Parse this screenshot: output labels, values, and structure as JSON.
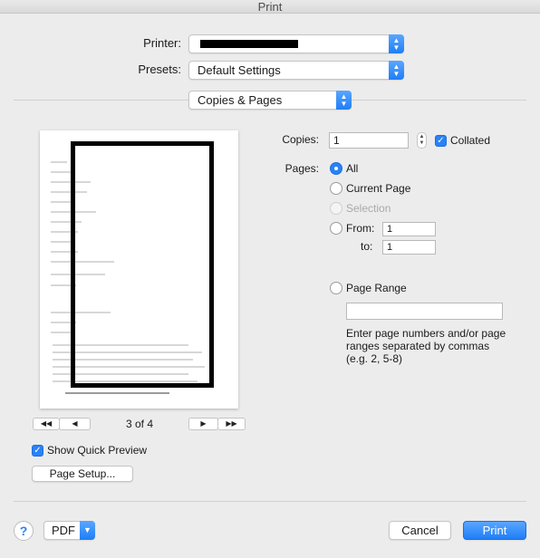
{
  "window": {
    "title": "Print"
  },
  "printer": {
    "label": "Printer:",
    "value": ""
  },
  "presets": {
    "label": "Presets:",
    "value": "Default Settings"
  },
  "section_popup": {
    "value": "Copies & Pages"
  },
  "preview": {
    "current_page": "3 of 4",
    "first_glyph": "◀◀",
    "prev_glyph": "◀",
    "next_glyph": "▶",
    "last_glyph": "▶▶",
    "page_text_lines": [
      "Prelude",
      "Welcome",
      "Time of",
      "Moment",
      "Tribute",
      "Come",
      "July",
      "Congregational",
      "Tuttle",
      "Newsletter",
      "Scripture",
      "Children",
      "Message",
      "The",
      "Benediction",
      "Postlude",
      "PRAYER REQUESTS",
      "Tiffany (Mock) Collier regarding pain management."
    ]
  },
  "show_quick_preview": {
    "label": "Show Quick Preview",
    "checked": true
  },
  "page_setup_button": "Page Setup...",
  "copies": {
    "label": "Copies:",
    "value": "1",
    "collated_label": "Collated",
    "collated": true
  },
  "pages": {
    "label": "Pages:",
    "options": [
      {
        "label": "All",
        "selected": true,
        "enabled": true
      },
      {
        "label": "Current Page",
        "selected": false,
        "enabled": true
      },
      {
        "label": "Selection",
        "selected": false,
        "enabled": false
      },
      {
        "label": "From:",
        "selected": false,
        "enabled": true
      }
    ],
    "from_value": "1",
    "to_label": "to:",
    "to_value": "1",
    "page_range_label": "Page Range",
    "page_range_value": "",
    "hint": "Enter page numbers and/or page ranges separated by commas (e.g. 2, 5-8)"
  },
  "footer": {
    "help_glyph": "?",
    "pdf_label": "PDF",
    "cancel_label": "Cancel",
    "print_label": "Print"
  },
  "colors": {
    "accent": "#2a82f7",
    "background": "#ececec"
  }
}
